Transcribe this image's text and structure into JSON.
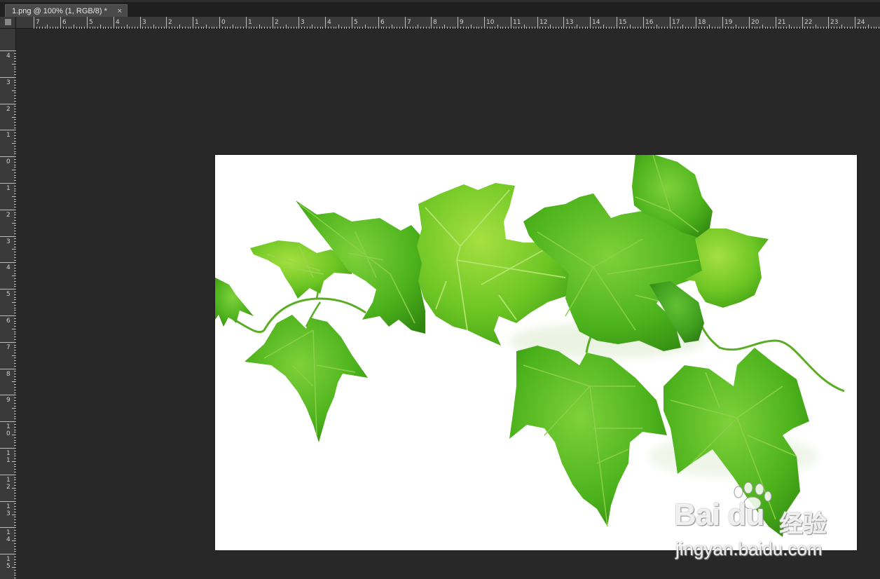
{
  "document": {
    "tab_title": "1.png @ 100% (1, RGB/8) *",
    "close_glyph": "×"
  },
  "rulers": {
    "top_labels": [
      "7",
      "6",
      "5",
      "4",
      "3",
      "2",
      "1",
      "0",
      "1",
      "2",
      "3",
      "4",
      "5",
      "6",
      "7",
      "8",
      "9",
      "10",
      "11",
      "12",
      "13",
      "14",
      "15",
      "16",
      "17",
      "18",
      "19",
      "20",
      "21",
      "22",
      "23",
      "24"
    ],
    "left_labels": [
      "4",
      "3",
      "2",
      "1",
      "0",
      "1",
      "2",
      "3",
      "4",
      "5",
      "6",
      "7",
      "8",
      "9",
      "10",
      "11",
      "12",
      "13",
      "14",
      "15"
    ]
  },
  "canvas": {
    "background": "#ffffff",
    "content": "green-vine-leaves-photo"
  },
  "watermark": {
    "logo_text": "Bai du",
    "chinese_text": "经验",
    "url_text": "jingyan.baidu.com"
  },
  "colors": {
    "workspace": "#282828",
    "ruler": "#3a3a3a",
    "tab_active": "#4a4a4a",
    "leaf_light": "#7ed321",
    "leaf_mid": "#4cbb17",
    "leaf_dark": "#2e8b12"
  }
}
